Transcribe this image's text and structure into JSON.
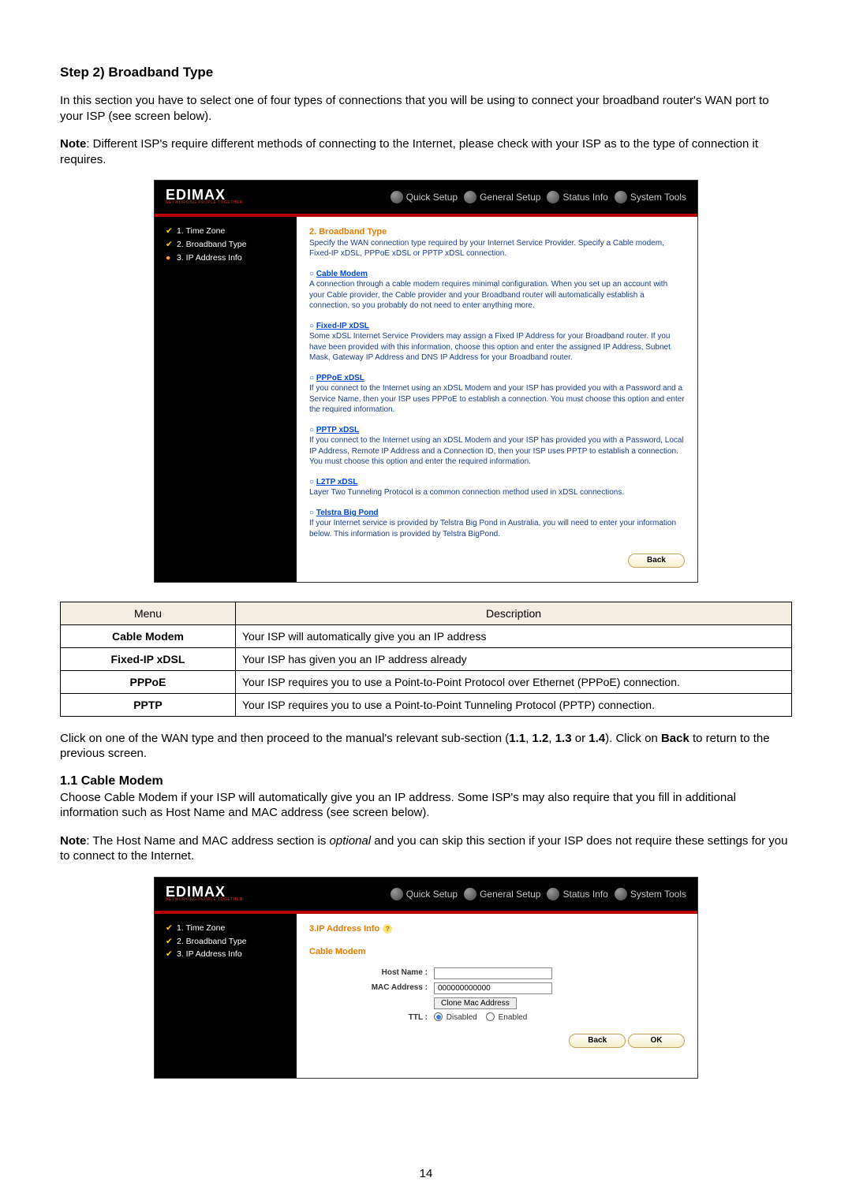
{
  "page_number": "14",
  "section": {
    "step_title": "Step 2) Broadband Type",
    "intro": "In this section you have to select one of four types of connections that you will be using to connect your broadband router's WAN port to your ISP (see screen below).",
    "note_label": "Note",
    "note_text": ": Different ISP's require different methods of connecting to the Internet, please check with your ISP as to the type of connection it requires.",
    "after_table_text": "Click on one of the WAN type and then proceed to the manual's relevant sub-section (",
    "after_table_sections": [
      "1.1",
      "1.2",
      "1.3",
      "1.4"
    ],
    "after_table_tail": "). Click on ",
    "after_table_back": "Back",
    "after_table_end": " to return to the previous screen.",
    "sub11_title": "1.1 Cable Modem",
    "sub11_p1": "Choose Cable Modem if your ISP will automatically give you an IP address. Some ISP's may also require that you fill in additional information such as Host Name and MAC address (see screen below).",
    "sub11_note_label": "Note",
    "sub11_note_a": ": The Host Name and MAC address section is ",
    "sub11_note_italic": "optional",
    "sub11_note_b": " and you can skip this section if your ISP does not require these settings for you to connect to the Internet."
  },
  "logo": {
    "brand": "EDIMAX",
    "tagline": "NETWORKING PEOPLE TOGETHER"
  },
  "nav": {
    "quick": "Quick Setup",
    "general": "General Setup",
    "status": "Status Info",
    "tools": "System Tools"
  },
  "shot1": {
    "side": {
      "i1": "1. Time Zone",
      "i2": "2. Broadband Type",
      "i3": "3. IP Address Info"
    },
    "title": "2. Broadband Type",
    "subtitle": "Specify the WAN connection type required by your Internet Service Provider. Specify a Cable modem, Fixed-IP xDSL, PPPoE xDSL or PPTP xDSL connection.",
    "opts": {
      "cable": {
        "head": "Cable Modem",
        "desc": "A connection through a cable modem requires minimal configuration. When you set up an account with your Cable provider, the Cable provider and your Broadband router will automatically establish a connection, so you probably do not need to enter anything more."
      },
      "fixed": {
        "head": "Fixed-IP xDSL",
        "desc": "Some xDSL Internet Service Providers may assign a Fixed IP Address for your Broadband router. If you have been provided with this information, choose this option and enter the assigned IP Address, Subnet Mask, Gateway IP Address and DNS IP Address for your Broadband router."
      },
      "pppoe": {
        "head": "PPPoE xDSL",
        "desc": "If you connect to the Internet using an xDSL Modem and your ISP has provided you with a Password and a Service Name, then your ISP uses PPPoE to establish a connection. You must choose this option and enter the required information."
      },
      "pptp": {
        "head": "PPTP xDSL",
        "desc": "If you connect to the Internet using an xDSL Modem and your ISP has provided you with a Password, Local IP Address, Remote IP Address and a Connection ID, then your ISP uses PPTP to establish a connection. You must choose this option and enter the required information."
      },
      "l2tp": {
        "head": "L2TP xDSL",
        "desc": "Layer Two Tunneling Protocol is a common connection method used in xDSL connections."
      },
      "telstra": {
        "head": "Telstra Big Pond",
        "desc": "If your Internet service is provided by Telstra Big Pond in Australia, you will need to enter your information below. This information is provided by Telstra BigPond."
      }
    },
    "back": "Back"
  },
  "desc_table": {
    "head_menu": "Menu",
    "head_desc": "Description",
    "rows": [
      {
        "menu": "Cable Modem",
        "desc": "Your ISP will automatically give you an IP address"
      },
      {
        "menu": "Fixed-IP xDSL",
        "desc": "Your ISP has given you an IP address already"
      },
      {
        "menu": "PPPoE",
        "desc": "Your ISP requires you to use a Point-to-Point Protocol over Ethernet (PPPoE) connection."
      },
      {
        "menu": "PPTP",
        "desc": "Your ISP requires you to use a Point-to-Point Tunneling Protocol (PPTP) connection."
      }
    ]
  },
  "shot2": {
    "side": {
      "i1": "1. Time Zone",
      "i2": "2. Broadband Type",
      "i3": "3. IP Address Info"
    },
    "title": "3.IP Address Info",
    "subtitle": "Cable Modem",
    "labels": {
      "host": "Host Name :",
      "mac": "MAC Address :",
      "ttl": "TTL :"
    },
    "values": {
      "host": "",
      "mac": "000000000000"
    },
    "clone": "Clone Mac Address",
    "ttl_disabled": "Disabled",
    "ttl_enabled": "Enabled",
    "back": "Back",
    "ok": "OK"
  }
}
